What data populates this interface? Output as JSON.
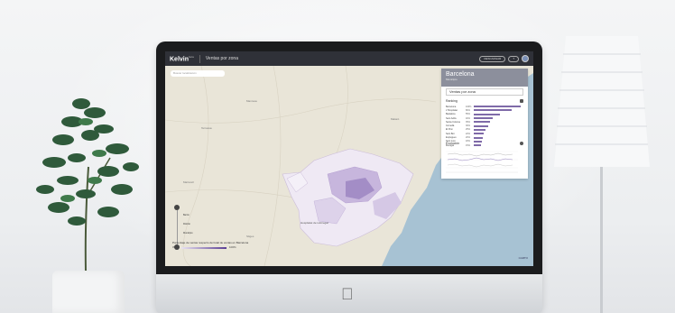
{
  "app": {
    "brand": "Kelvin",
    "brand_sup": "beta",
    "title": "Ventas por zona",
    "search_placeholder": "Buscar localización",
    "top_pill": "DESCARGAR",
    "top_pill2": "?"
  },
  "panel": {
    "city": "Barcelona",
    "subtitle": "Municipio",
    "metric": "Ventas por zona",
    "ranking_title": "Ranking",
    "evolution_title": "Evolución",
    "ranking": [
      {
        "name": "Barcelona",
        "value": "100%",
        "fraction": 1.0
      },
      {
        "name": "L'Hospitalet",
        "value": "80%",
        "fraction": 0.8
      },
      {
        "name": "Badalona",
        "value": "55%",
        "fraction": 0.55
      },
      {
        "name": "Sant Adrià",
        "value": "40%",
        "fraction": 0.4
      },
      {
        "name": "Santa Coloma",
        "value": "35%",
        "fraction": 0.35
      },
      {
        "name": "Cornellà",
        "value": "30%",
        "fraction": 0.3
      },
      {
        "name": "El Prat",
        "value": "25%",
        "fraction": 0.25
      },
      {
        "name": "Sant Boi",
        "value": "22%",
        "fraction": 0.22
      },
      {
        "name": "Esplugues",
        "value": "20%",
        "fraction": 0.2
      },
      {
        "name": "Sant Just",
        "value": "18%",
        "fraction": 0.18
      },
      {
        "name": "Montgat",
        "value": "15%",
        "fraction": 0.15
      }
    ]
  },
  "zoom": {
    "labels": [
      "Barrio",
      "Distrito",
      "Municipio"
    ]
  },
  "legend": {
    "title": "Porcentaje de ventas respecto del total de ventas en Barcelona",
    "min": "0%",
    "max": "100%"
  },
  "map": {
    "city_label": "Barcelona",
    "attribution": "CARTO"
  },
  "colors": {
    "accent": "#7f6aa8",
    "topbar": "#2f3138",
    "sea": "#a7c2d3",
    "land": "#e9e5d8"
  }
}
